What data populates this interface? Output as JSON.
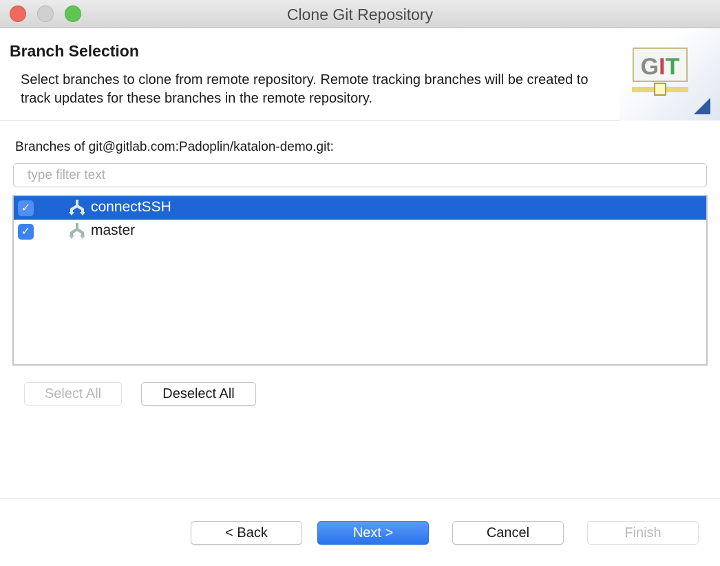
{
  "window": {
    "title": "Clone Git Repository"
  },
  "header": {
    "title": "Branch Selection",
    "description": "Select branches to clone from remote repository. Remote tracking branches will be created to track updates for these branches in the remote repository.",
    "logo_text": "GIT"
  },
  "branches": {
    "label": "Branches of git@gitlab.com:Padoplin/katalon-demo.git:",
    "filter_placeholder": "type filter text",
    "filter_value": "",
    "items": [
      {
        "name": "connectSSH",
        "checked": true,
        "selected": true,
        "icon": "branch-icon"
      },
      {
        "name": "master",
        "checked": true,
        "selected": false,
        "icon": "branch-icon"
      }
    ],
    "select_all": "Select All",
    "deselect_all": "Deselect All"
  },
  "footer": {
    "back": "< Back",
    "next": "Next >",
    "cancel": "Cancel",
    "finish": "Finish"
  },
  "colors": {
    "accent": "#1e66d6",
    "close": "#ee6a5f",
    "minimize": "#d0d0d0",
    "zoom": "#61c554"
  }
}
